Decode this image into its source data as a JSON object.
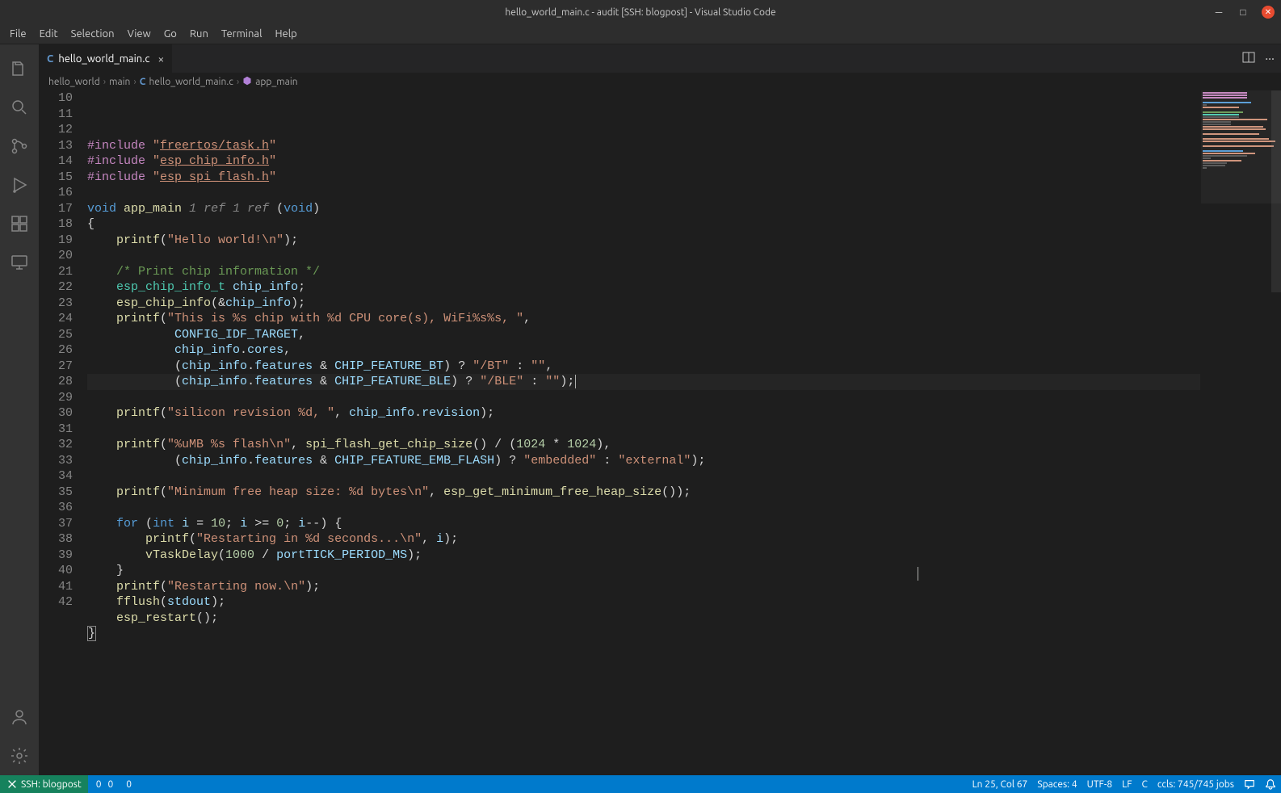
{
  "window": {
    "title": "hello_world_main.c - audit [SSH: blogpost] - Visual Studio Code"
  },
  "menu": [
    "File",
    "Edit",
    "Selection",
    "View",
    "Go",
    "Run",
    "Terminal",
    "Help"
  ],
  "tab": {
    "icon_letter": "C",
    "filename": "hello_world_main.c"
  },
  "breadcrumbs": {
    "parts": [
      "hello_world",
      "main"
    ],
    "file_icon": "C",
    "file": "hello_world_main.c",
    "symbol_icon": "⦿",
    "symbol": "app_main"
  },
  "code": {
    "first_line": 10,
    "lines": [
      {
        "n": 10,
        "seg": [
          [
            "pp",
            "#include "
          ],
          [
            "str",
            "\""
          ],
          [
            "str-u",
            "freertos/task.h"
          ],
          [
            "str",
            "\""
          ]
        ]
      },
      {
        "n": 11,
        "seg": [
          [
            "pp",
            "#include "
          ],
          [
            "str",
            "\""
          ],
          [
            "str-u",
            "esp_chip_info.h"
          ],
          [
            "str",
            "\""
          ]
        ]
      },
      {
        "n": 12,
        "seg": [
          [
            "pp",
            "#include "
          ],
          [
            "str",
            "\""
          ],
          [
            "str-u",
            "esp_spi_flash.h"
          ],
          [
            "str",
            "\""
          ]
        ]
      },
      {
        "n": 13,
        "seg": []
      },
      {
        "n": 14,
        "seg": [
          [
            "kw",
            "void"
          ],
          [
            "",
            " "
          ],
          [
            "fn",
            "app_main"
          ],
          [
            "",
            " "
          ],
          [
            "hint",
            "1 ref 1 ref "
          ],
          [
            "paren",
            "("
          ],
          [
            "kw",
            "void"
          ],
          [
            "paren",
            ")"
          ]
        ]
      },
      {
        "n": 15,
        "seg": [
          [
            "op",
            "{"
          ]
        ]
      },
      {
        "n": 16,
        "seg": [
          [
            "",
            "    "
          ],
          [
            "fn",
            "printf"
          ],
          [
            "paren",
            "("
          ],
          [
            "str",
            "\"Hello world!\\n\""
          ],
          [
            "paren",
            ")"
          ],
          [
            "op",
            ";"
          ]
        ]
      },
      {
        "n": 17,
        "seg": []
      },
      {
        "n": 18,
        "seg": [
          [
            "",
            "    "
          ],
          [
            "cm",
            "/* Print chip information */"
          ]
        ]
      },
      {
        "n": 19,
        "seg": [
          [
            "",
            "    "
          ],
          [
            "type",
            "esp_chip_info_t"
          ],
          [
            "",
            " "
          ],
          [
            "var",
            "chip_info"
          ],
          [
            "op",
            ";"
          ]
        ]
      },
      {
        "n": 20,
        "seg": [
          [
            "",
            "    "
          ],
          [
            "fn",
            "esp_chip_info"
          ],
          [
            "paren",
            "("
          ],
          [
            "op",
            "&"
          ],
          [
            "var",
            "chip_info"
          ],
          [
            "paren",
            ")"
          ],
          [
            "op",
            ";"
          ]
        ]
      },
      {
        "n": 21,
        "seg": [
          [
            "",
            "    "
          ],
          [
            "fn",
            "printf"
          ],
          [
            "paren",
            "("
          ],
          [
            "str",
            "\"This is %s chip with %d CPU core(s), WiFi%s%s, \""
          ],
          [
            "op",
            ","
          ]
        ]
      },
      {
        "n": 22,
        "seg": [
          [
            "",
            "            "
          ],
          [
            "var",
            "CONFIG_IDF_TARGET"
          ],
          [
            "op",
            ","
          ]
        ]
      },
      {
        "n": 23,
        "seg": [
          [
            "",
            "            "
          ],
          [
            "var",
            "chip_info"
          ],
          [
            "op",
            "."
          ],
          [
            "mem",
            "cores"
          ],
          [
            "op",
            ","
          ]
        ]
      },
      {
        "n": 24,
        "seg": [
          [
            "",
            "            "
          ],
          [
            "paren",
            "("
          ],
          [
            "var",
            "chip_info"
          ],
          [
            "op",
            "."
          ],
          [
            "mem",
            "features"
          ],
          [
            "",
            " "
          ],
          [
            "op",
            "&"
          ],
          [
            "",
            " "
          ],
          [
            "var",
            "CHIP_FEATURE_BT"
          ],
          [
            "paren",
            ")"
          ],
          [
            "",
            " "
          ],
          [
            "op",
            "?"
          ],
          [
            "",
            " "
          ],
          [
            "str",
            "\"/BT\""
          ],
          [
            "",
            " "
          ],
          [
            "op",
            ":"
          ],
          [
            "",
            " "
          ],
          [
            "str",
            "\"\""
          ],
          [
            "op",
            ","
          ]
        ]
      },
      {
        "n": 25,
        "hl": true,
        "seg": [
          [
            "",
            "            "
          ],
          [
            "paren",
            "("
          ],
          [
            "var",
            "chip_info"
          ],
          [
            "op",
            "."
          ],
          [
            "mem",
            "features"
          ],
          [
            "",
            " "
          ],
          [
            "op",
            "&"
          ],
          [
            "",
            " "
          ],
          [
            "var",
            "CHIP_FEATURE_BLE"
          ],
          [
            "paren",
            ")"
          ],
          [
            "",
            " "
          ],
          [
            "op",
            "?"
          ],
          [
            "",
            " "
          ],
          [
            "str",
            "\"/BLE\""
          ],
          [
            "",
            " "
          ],
          [
            "op",
            ":"
          ],
          [
            "",
            " "
          ],
          [
            "str",
            "\"\""
          ],
          [
            "paren",
            ")"
          ],
          [
            "op",
            ";"
          ]
        ],
        "cursor_after": true
      },
      {
        "n": 26,
        "seg": []
      },
      {
        "n": 27,
        "seg": [
          [
            "",
            "    "
          ],
          [
            "fn",
            "printf"
          ],
          [
            "paren",
            "("
          ],
          [
            "str",
            "\"silicon revision %d, \""
          ],
          [
            "op",
            ", "
          ],
          [
            "var",
            "chip_info"
          ],
          [
            "op",
            "."
          ],
          [
            "mem",
            "revision"
          ],
          [
            "paren",
            ")"
          ],
          [
            "op",
            ";"
          ]
        ]
      },
      {
        "n": 28,
        "seg": []
      },
      {
        "n": 29,
        "seg": [
          [
            "",
            "    "
          ],
          [
            "fn",
            "printf"
          ],
          [
            "paren",
            "("
          ],
          [
            "str",
            "\"%uMB %s flash\\n\""
          ],
          [
            "op",
            ", "
          ],
          [
            "fn",
            "spi_flash_get_chip_size"
          ],
          [
            "paren",
            "()"
          ],
          [
            "",
            " "
          ],
          [
            "op",
            "/"
          ],
          [
            "",
            " "
          ],
          [
            "paren",
            "("
          ],
          [
            "num",
            "1024"
          ],
          [
            "",
            " "
          ],
          [
            "op",
            "*"
          ],
          [
            "",
            " "
          ],
          [
            "num",
            "1024"
          ],
          [
            "paren",
            ")"
          ],
          [
            "op",
            ","
          ]
        ]
      },
      {
        "n": 30,
        "seg": [
          [
            "",
            "            "
          ],
          [
            "paren",
            "("
          ],
          [
            "var",
            "chip_info"
          ],
          [
            "op",
            "."
          ],
          [
            "mem",
            "features"
          ],
          [
            "",
            " "
          ],
          [
            "op",
            "&"
          ],
          [
            "",
            " "
          ],
          [
            "var",
            "CHIP_FEATURE_EMB_FLASH"
          ],
          [
            "paren",
            ")"
          ],
          [
            "",
            " "
          ],
          [
            "op",
            "?"
          ],
          [
            "",
            " "
          ],
          [
            "str",
            "\"embedded\""
          ],
          [
            "",
            " "
          ],
          [
            "op",
            ":"
          ],
          [
            "",
            " "
          ],
          [
            "str",
            "\"external\""
          ],
          [
            "paren",
            ")"
          ],
          [
            "op",
            ";"
          ]
        ]
      },
      {
        "n": 31,
        "seg": []
      },
      {
        "n": 32,
        "seg": [
          [
            "",
            "    "
          ],
          [
            "fn",
            "printf"
          ],
          [
            "paren",
            "("
          ],
          [
            "str",
            "\"Minimum free heap size: %d bytes\\n\""
          ],
          [
            "op",
            ", "
          ],
          [
            "fn",
            "esp_get_minimum_free_heap_size"
          ],
          [
            "paren",
            "()"
          ],
          [
            "paren",
            ")"
          ],
          [
            "op",
            ";"
          ]
        ]
      },
      {
        "n": 33,
        "seg": []
      },
      {
        "n": 34,
        "seg": [
          [
            "",
            "    "
          ],
          [
            "kw",
            "for"
          ],
          [
            "",
            " "
          ],
          [
            "paren",
            "("
          ],
          [
            "kw",
            "int"
          ],
          [
            "",
            " "
          ],
          [
            "var",
            "i"
          ],
          [
            "",
            " "
          ],
          [
            "op",
            "="
          ],
          [
            "",
            " "
          ],
          [
            "num",
            "10"
          ],
          [
            "op",
            "; "
          ],
          [
            "var",
            "i"
          ],
          [
            "",
            " "
          ],
          [
            "op",
            ">="
          ],
          [
            "",
            " "
          ],
          [
            "num",
            "0"
          ],
          [
            "op",
            "; "
          ],
          [
            "var",
            "i"
          ],
          [
            "op",
            "--"
          ],
          [
            "paren",
            ")"
          ],
          [
            "",
            " "
          ],
          [
            "op",
            "{"
          ]
        ]
      },
      {
        "n": 35,
        "seg": [
          [
            "",
            "        "
          ],
          [
            "fn",
            "printf"
          ],
          [
            "paren",
            "("
          ],
          [
            "str",
            "\"Restarting in %d seconds...\\n\""
          ],
          [
            "op",
            ", "
          ],
          [
            "var",
            "i"
          ],
          [
            "paren",
            ")"
          ],
          [
            "op",
            ";"
          ]
        ]
      },
      {
        "n": 36,
        "seg": [
          [
            "",
            "        "
          ],
          [
            "fn",
            "vTaskDelay"
          ],
          [
            "paren",
            "("
          ],
          [
            "num",
            "1000"
          ],
          [
            "",
            " "
          ],
          [
            "op",
            "/"
          ],
          [
            "",
            " "
          ],
          [
            "var",
            "portTICK_PERIOD_MS"
          ],
          [
            "paren",
            ")"
          ],
          [
            "op",
            ";"
          ]
        ]
      },
      {
        "n": 37,
        "seg": [
          [
            "",
            "    "
          ],
          [
            "op",
            "}"
          ]
        ]
      },
      {
        "n": 38,
        "seg": [
          [
            "",
            "    "
          ],
          [
            "fn",
            "printf"
          ],
          [
            "paren",
            "("
          ],
          [
            "str",
            "\"Restarting now.\\n\""
          ],
          [
            "paren",
            ")"
          ],
          [
            "op",
            ";"
          ]
        ]
      },
      {
        "n": 39,
        "seg": [
          [
            "",
            "    "
          ],
          [
            "fn",
            "fflush"
          ],
          [
            "paren",
            "("
          ],
          [
            "var",
            "stdout"
          ],
          [
            "paren",
            ")"
          ],
          [
            "op",
            ";"
          ]
        ]
      },
      {
        "n": 40,
        "seg": [
          [
            "",
            "    "
          ],
          [
            "fn",
            "esp_restart"
          ],
          [
            "paren",
            "()"
          ],
          [
            "op",
            ";"
          ]
        ]
      },
      {
        "n": 41,
        "seg": [
          [
            "brace-box",
            "}"
          ]
        ]
      },
      {
        "n": 42,
        "seg": []
      }
    ]
  },
  "status": {
    "remote": "SSH: blogpost",
    "errors": "0",
    "warnings": "0",
    "radio": "0",
    "cursor": "Ln 25, Col 67",
    "spaces": "Spaces: 4",
    "encoding": "UTF-8",
    "eol": "LF",
    "lang": "C",
    "ccls": "ccls: 745/745 jobs"
  }
}
